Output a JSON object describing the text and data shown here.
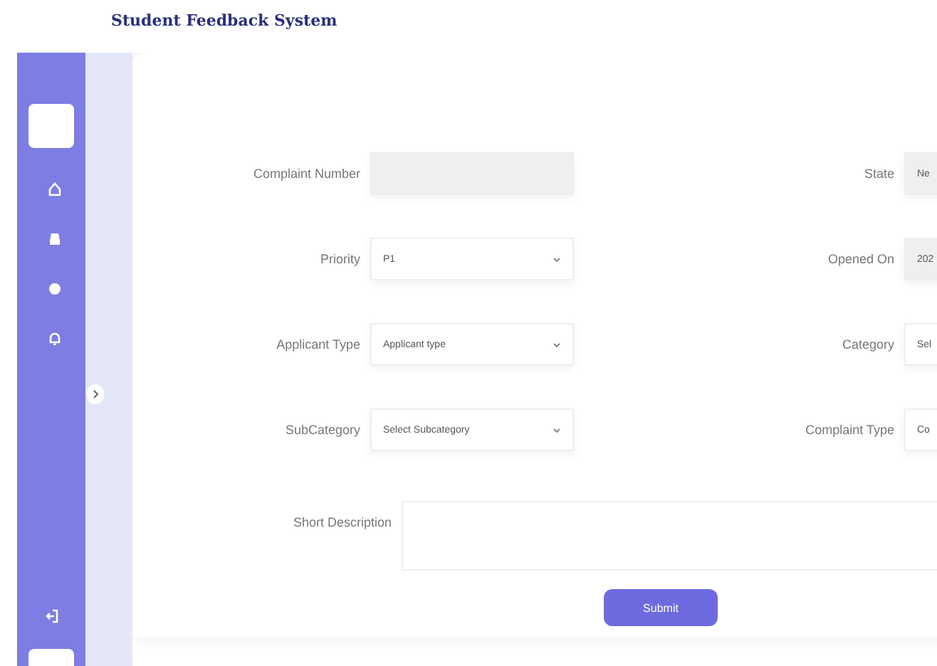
{
  "header": {
    "title": "Student Feedback System"
  },
  "form": {
    "fields": [
      {
        "label": "Complaint Number",
        "kind": "text",
        "disabled": true
      },
      {
        "label": "State",
        "kind": "text",
        "value": "Ne",
        "disabled": true
      },
      {
        "label": "Priority",
        "kind": "select",
        "value": "P1",
        "disabled": false
      },
      {
        "label": "Opened On",
        "kind": "text",
        "value": "202",
        "disabled": true
      },
      {
        "label": "Applicant Type",
        "kind": "select",
        "value": "Applicant type",
        "disabled": false
      },
      {
        "label": "Category",
        "kind": "select",
        "value": "Sel",
        "disabled": false
      },
      {
        "label": "SubCategory",
        "kind": "select",
        "value": "Select Subcategory",
        "disabled": false
      },
      {
        "label": "Complaint Type",
        "kind": "select",
        "value": "Co",
        "disabled": false
      }
    ],
    "description": {
      "label": "Short Description"
    },
    "submit": "Submit"
  }
}
